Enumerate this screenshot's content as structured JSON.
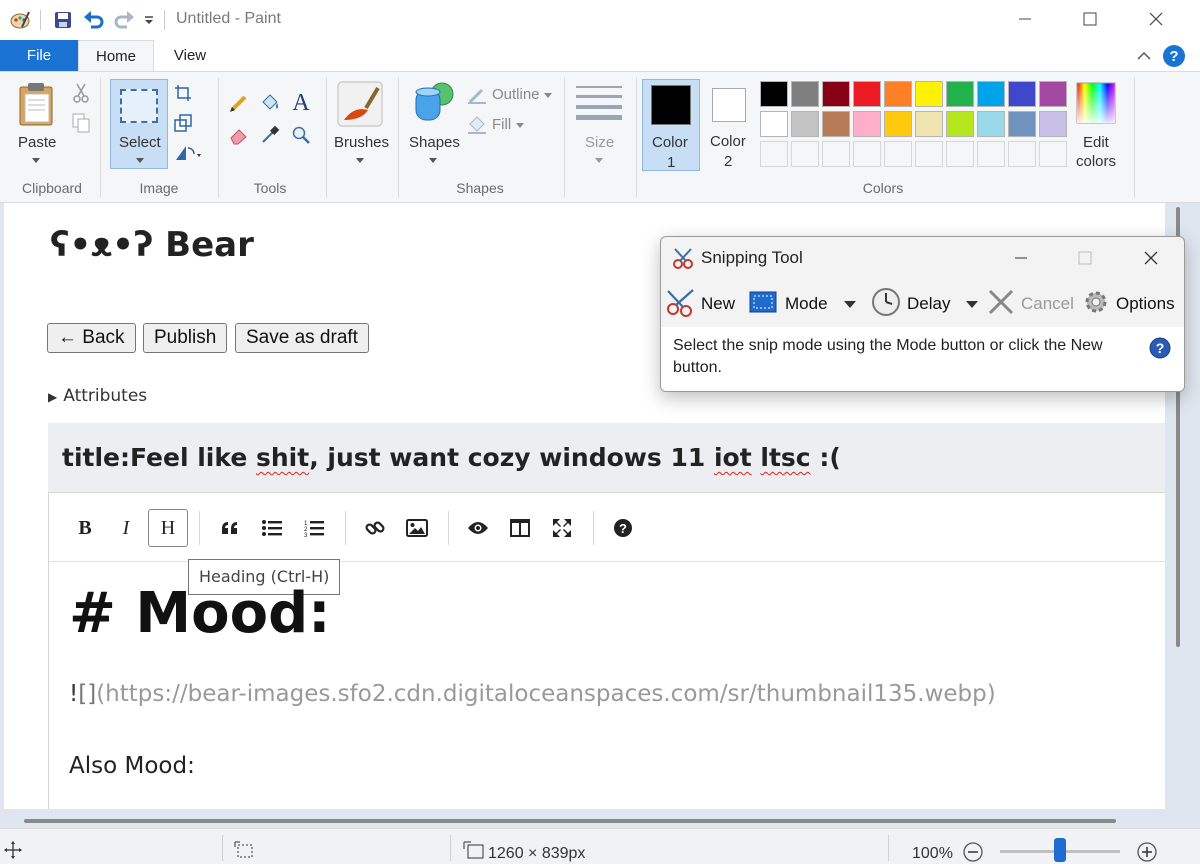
{
  "window": {
    "title": "Untitled - Paint",
    "quick_access": [
      "paint-app-icon",
      "save-icon",
      "undo-icon",
      "redo-icon",
      "customize-qat-icon"
    ]
  },
  "tabs": [
    {
      "label": "File"
    },
    {
      "label": "Home"
    },
    {
      "label": "View"
    }
  ],
  "ribbon": {
    "clipboard": {
      "group_label": "Clipboard",
      "paste": "Paste"
    },
    "image": {
      "group_label": "Image",
      "select": "Select"
    },
    "tools": {
      "group_label": "Tools"
    },
    "shapes_group": {
      "group_label": "Shapes",
      "brushes": "Brushes",
      "shapes": "Shapes",
      "outline": "Outline",
      "fill": "Fill"
    },
    "size": "Size",
    "colors": {
      "group_label": "Colors",
      "color1": "Color",
      "color1_num": "1",
      "color2": "Color",
      "color2_num": "2",
      "edit": "Edit",
      "edit2": "colors",
      "color1_value": "#000000",
      "color2_value": "#ffffff",
      "palette_row1": [
        "#000000",
        "#7f7f7f",
        "#880015",
        "#ed1c24",
        "#ff7f27",
        "#fff200",
        "#22b14c",
        "#00a2e8",
        "#3f48cc",
        "#a349a4"
      ],
      "palette_row2": [
        "#ffffff",
        "#c3c3c3",
        "#b97a57",
        "#ffaec9",
        "#ffc90e",
        "#efe4b0",
        "#b5e61d",
        "#99d9ea",
        "#7092be",
        "#c8bfe7"
      ]
    }
  },
  "page": {
    "bear_face": "ʕ•ᴥ•ʔ",
    "bear_title": "Bear",
    "back": "← Back",
    "publish": "Publish",
    "save_draft": "Save as draft",
    "attributes": "Attributes",
    "title_prefix": "title:Feel like ",
    "title_word1": "shit",
    "title_mid": ", just want cozy windows 11 ",
    "title_word2": "iot",
    "title_space": " ",
    "title_word3": "ltsc",
    "title_end": " :(",
    "tooltip": "Heading (Ctrl-H)",
    "md_heading": "# Mood:",
    "md_image_bang": "!",
    "md_image_brackets": "[]",
    "md_image_url": "(https://bear-images.sfo2.cdn.digitaloceanspaces.com/sr/thumbnail135.webp)",
    "md_text": "Also Mood:"
  },
  "editor_toolbar": [
    "bold-icon",
    "italic-icon",
    "heading-icon",
    "quote-icon",
    "unordered-list-icon",
    "ordered-list-icon",
    "link-icon",
    "image-icon",
    "preview-icon",
    "side-by-side-icon",
    "fullscreen-icon",
    "help-icon"
  ],
  "snipping_tool": {
    "title": "Snipping Tool",
    "new": "New",
    "mode": "Mode",
    "delay": "Delay",
    "cancel": "Cancel",
    "options": "Options",
    "message": "Select the snip mode using the Mode button or click the New button."
  },
  "status": {
    "canvas_size": "1260 × 839px",
    "zoom": "100%",
    "zoom_level": 0.5
  }
}
